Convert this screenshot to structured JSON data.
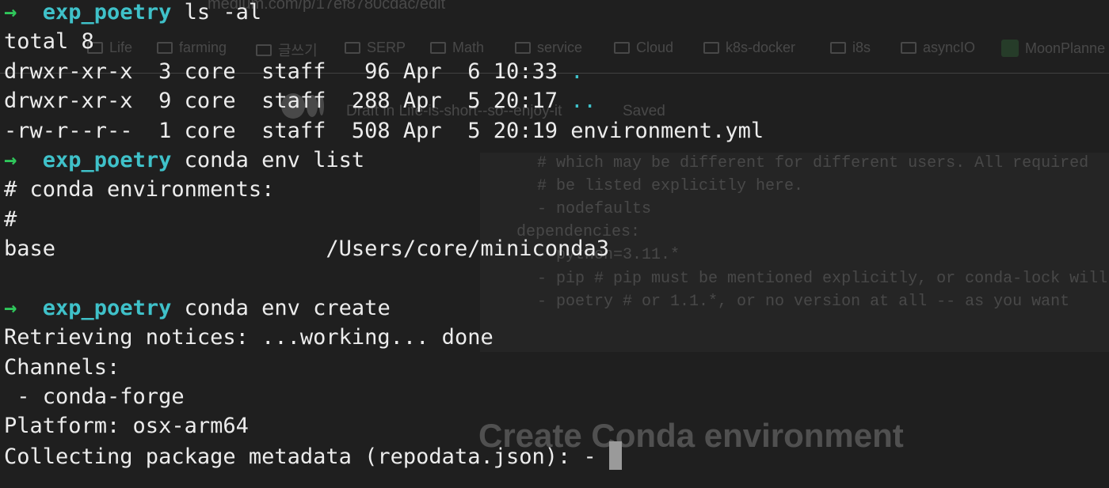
{
  "background": {
    "url_text": "medium.com/p/17ef8780cdac/edit",
    "bookmarks": [
      {
        "label": "Life",
        "icon": "folder-icon"
      },
      {
        "label": "farming",
        "icon": "folder-icon"
      },
      {
        "label": "글쓰기",
        "icon": "folder-icon"
      },
      {
        "label": "SERP",
        "icon": "folder-icon"
      },
      {
        "label": "Math",
        "icon": "folder-icon"
      },
      {
        "label": "service",
        "icon": "folder-icon"
      },
      {
        "label": "Cloud",
        "icon": "folder-icon"
      },
      {
        "label": "k8s-docker",
        "icon": "folder-icon"
      },
      {
        "label": "i8s",
        "icon": "folder-icon"
      },
      {
        "label": "asyncIO",
        "icon": "folder-icon"
      },
      {
        "label": "MoonPlanne",
        "icon": "moonplanner-icon"
      }
    ],
    "draft_text": "Draft in Life-is-short--so--enjoy-it",
    "saved_text": "Saved",
    "code_lines": [
      "# which may be different for different users. All required",
      "# be listed explicitly here.",
      "- nodefaults",
      "dependencies:",
      "- python=3.11.*",
      "- pip # pip must be mentioned explicitly, or conda-lock will",
      "- poetry # or 1.1.*, or no version at all -- as you want"
    ],
    "heading": "Create Conda environment"
  },
  "terminal": {
    "prompt_symbol": "→",
    "prompt_dir": "exp_poetry",
    "cmd1": "ls -al",
    "total": "total 8",
    "ls_rows": [
      {
        "text": "drwxr-xr-x  3 core  staff   96 Apr  6 10:33 ",
        "name": "."
      },
      {
        "text": "drwxr-xr-x  9 core  staff  288 Apr  5 20:17 ",
        "name": ".."
      },
      {
        "text": "-rw-r--r--  1 core  staff  508 Apr  5 20:19 ",
        "name": "environment.yml"
      }
    ],
    "cmd2": "conda env list",
    "env_header": "# conda environments:",
    "env_hash": "#",
    "env_row": "base                     /Users/core/miniconda3",
    "cmd3": "conda env create",
    "out_lines": [
      "Retrieving notices: ...working... done",
      "Channels:",
      " - conda-forge",
      "Platform: osx-arm64",
      "Collecting package metadata (repodata.json): - "
    ]
  }
}
